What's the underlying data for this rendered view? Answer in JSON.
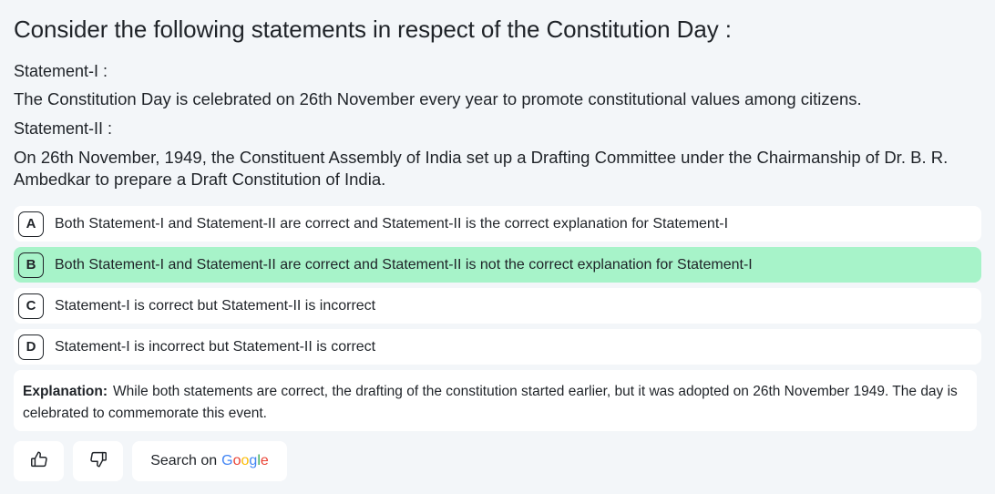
{
  "question": {
    "title": "Consider the following statements in respect of the Constitution Day :",
    "statement1_label": "Statement-I :",
    "statement1_text": "The Constitution Day is celebrated on 26th November every year to promote constitutional values among citizens.",
    "statement2_label": "Statement-II :",
    "statement2_text": "On 26th November, 1949, the Constituent Assembly of India set up a Drafting Committee under the Chairmanship of Dr. B. R. Ambedkar to prepare a Draft Constitution of India."
  },
  "options": [
    {
      "letter": "A",
      "text": "Both Statement-I and Statement-II are correct and Statement-II is the correct explanation for Statement-I",
      "selected": false
    },
    {
      "letter": "B",
      "text": "Both Statement-I and Statement-II are correct and Statement-II is not the correct explanation for Statement-I",
      "selected": true
    },
    {
      "letter": "C",
      "text": "Statement-I is correct but Statement-II is incorrect",
      "selected": false
    },
    {
      "letter": "D",
      "text": "Statement-I is incorrect but Statement-II is correct",
      "selected": false
    }
  ],
  "explanation": {
    "label": "Explanation:",
    "text": "While both statements are correct, the drafting of the constitution started earlier, but it was adopted on 26th November 1949. The day is celebrated to commemorate this event."
  },
  "actions": {
    "like_icon": "thumbs-up-icon",
    "dislike_icon": "thumbs-down-icon",
    "search_label": "Search on",
    "search_brand": "Google",
    "google_colors": [
      "#4285F4",
      "#EA4335",
      "#FBBC05",
      "#4285F4",
      "#34A853",
      "#EA4335"
    ]
  },
  "colors": {
    "background": "#f3f6f9",
    "selected_option": "#a7f3c9",
    "card": "#ffffff"
  }
}
